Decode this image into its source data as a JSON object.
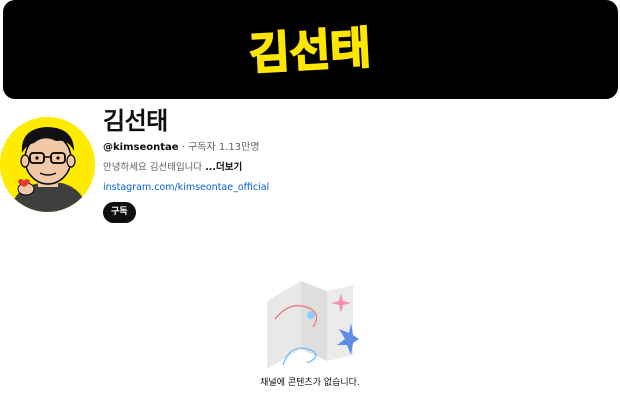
{
  "banner": {
    "text": "김선태"
  },
  "channel": {
    "name": "김선태",
    "handle": "@kimseontae",
    "separator": "·",
    "subscribers": "구독자 1.13만명",
    "description": "안녕하세요 김선태입니다",
    "more_label": "...더보기",
    "link": "instagram.com/kimseontae_official"
  },
  "actions": {
    "subscribe_label": "구독"
  },
  "empty_state": {
    "message": "채널에 콘텐츠가 없습니다."
  },
  "colors": {
    "banner_bg": "#000000",
    "banner_text": "#ffe600",
    "avatar_bg": "#ffeb00",
    "link": "#065fd4",
    "button_bg": "#0f0f0f"
  }
}
